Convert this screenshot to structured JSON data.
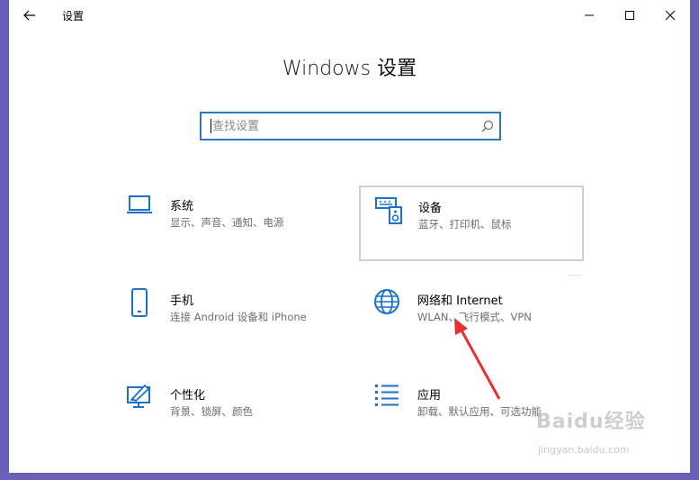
{
  "window": {
    "title": "设置"
  },
  "page": {
    "heading": "Windows 设置"
  },
  "search": {
    "placeholder": "查找设置",
    "value": ""
  },
  "tiles": [
    {
      "title": "系统",
      "desc": "显示、声音、通知、电源",
      "icon": "laptop-icon"
    },
    {
      "title": "设备",
      "desc": "蓝牙、打印机、鼠标",
      "icon": "keyboard-speaker-icon"
    },
    {
      "title": "手机",
      "desc": "连接 Android 设备和 iPhone",
      "icon": "phone-icon"
    },
    {
      "title": "网络和 Internet",
      "desc": "WLAN、飞行模式、VPN",
      "icon": "globe-icon"
    },
    {
      "title": "个性化",
      "desc": "背景、锁屏、颜色",
      "icon": "paint-brush-icon"
    },
    {
      "title": "应用",
      "desc": "卸载、默认应用、可选功能",
      "icon": "apps-list-icon"
    }
  ],
  "watermark": {
    "main": "Baidu经验",
    "sub": "jingyan.baidu.com"
  },
  "colors": {
    "accent": "#2b79c2",
    "annotation_arrow": "#e8302e",
    "desktop": "#6a5fb6"
  }
}
